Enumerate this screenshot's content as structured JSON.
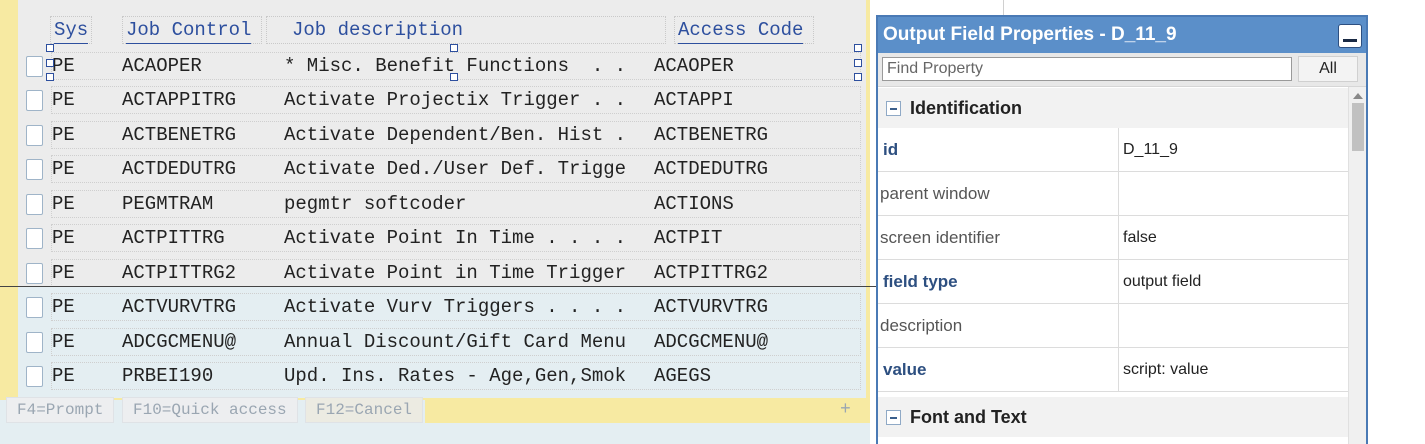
{
  "table": {
    "headers": {
      "sys": "Sys",
      "job": "Job Control",
      "desc": "Job description",
      "access": "Access Code"
    },
    "rows": [
      {
        "sys": "PE",
        "job": "ACAOPER",
        "desc": "* Misc. Benefit Functions  . .",
        "access": "ACAOPER"
      },
      {
        "sys": "PE",
        "job": "ACTAPPITRG",
        "desc": "Activate Projectix Trigger . .",
        "access": "ACTAPPI"
      },
      {
        "sys": "PE",
        "job": "ACTBENETRG",
        "desc": "Activate Dependent/Ben. Hist .",
        "access": "ACTBENETRG"
      },
      {
        "sys": "PE",
        "job": "ACTDEDUTRG",
        "desc": "Activate Ded./User Def. Trigge",
        "access": "ACTDEDUTRG"
      },
      {
        "sys": "PE",
        "job": "PEGMTRAM",
        "desc": "pegmtr softcoder",
        "access": "ACTIONS"
      },
      {
        "sys": "PE",
        "job": "ACTPITTRG",
        "desc": "Activate Point In Time . . . .",
        "access": "ACTPIT"
      },
      {
        "sys": "PE",
        "job": "ACTPITTRG2",
        "desc": "Activate Point in Time Trigger",
        "access": "ACTPITTRG2"
      },
      {
        "sys": "PE",
        "job": "ACTVURVTRG",
        "desc": "Activate Vurv Triggers . . . .",
        "access": "ACTVURVTRG"
      },
      {
        "sys": "PE",
        "job": "ADCGCMENU@",
        "desc": "Annual Discount/Gift Card Menu",
        "access": "ADCGCMENU@"
      },
      {
        "sys": "PE",
        "job": "PRBEI190",
        "desc": "Upd. Ins. Rates - Age,Gen,Smok",
        "access": "AGEGS"
      }
    ]
  },
  "fkeys": {
    "f4": "F4=Prompt",
    "f10": "F10=Quick access",
    "f12": "F12=Cancel",
    "plus": "+"
  },
  "panel": {
    "title": "Output Field Properties - D_11_9",
    "find_placeholder": "Find Property",
    "all_label": "All",
    "sections": {
      "identification": "Identification",
      "font_text": "Font and Text"
    },
    "properties": [
      {
        "name": "id",
        "value": "D_11_9"
      },
      {
        "name": "parent window",
        "value": ""
      },
      {
        "name": "screen identifier",
        "value": "false"
      },
      {
        "name": "field type",
        "value": "output field"
      },
      {
        "name": "description",
        "value": ""
      },
      {
        "name": "value",
        "value": "script: value"
      }
    ]
  },
  "colors": {
    "frame_yellow": "#f7eaa2",
    "header_blue": "#2d4f9e",
    "panel_title_bg": "#5b8fc9"
  }
}
